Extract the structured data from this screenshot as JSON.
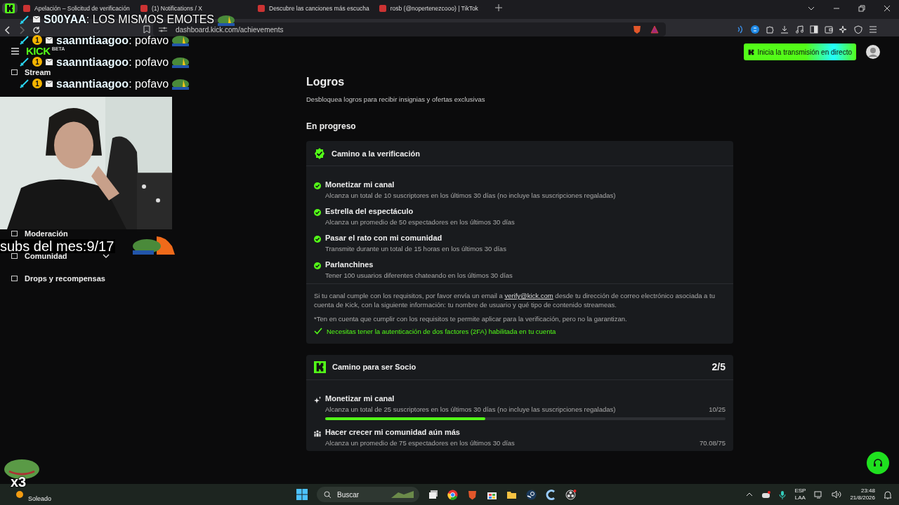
{
  "browser": {
    "tabs": [
      {
        "kind": "pinned",
        "selected": true
      },
      {
        "kind": "tab",
        "title": "Apelación – Solicitud de verificación",
        "selected": false
      },
      {
        "kind": "tab",
        "title": "(1) Notifications / X",
        "selected": false
      },
      {
        "kind": "tab",
        "title": "Descubre las canciones más escucha",
        "selected": false
      },
      {
        "kind": "tab",
        "title": "rosb (@nopertenezcooo) | TikTok",
        "selected": false
      }
    ],
    "address": "dashboard.kick.com/achievements"
  },
  "sidebar": {
    "logo": "KICK",
    "logo_badge": "BETA",
    "items": [
      {
        "label": "Stream",
        "kind": "link"
      },
      {
        "label": "Moderación",
        "kind": "link"
      },
      {
        "label": "Comunidad",
        "kind": "group",
        "expanded": false
      },
      {
        "label": "Drops y recompensas",
        "kind": "link"
      }
    ]
  },
  "header": {
    "live_button": "Inicia la transmisión en directo"
  },
  "page": {
    "title": "Logros",
    "subtitle": "Desbloquea logros para recibir insignias y ofertas exclusivas",
    "section": "En progreso"
  },
  "cards": [
    {
      "kind": "verification",
      "title": "Camino a la verificación",
      "items": [
        {
          "title": "Monetizar mi canal",
          "description": "Alcanza un total de 10 suscriptores en los últimos 30 días (no incluye las suscripciones regaladas)",
          "done": true
        },
        {
          "title": "Estrella del espectáculo",
          "description": "Alcanza un promedio de 50 espectadores en los últimos 30 días",
          "done": true
        },
        {
          "title": "Pasar el rato con mi comunidad",
          "description": "Transmite durante un total de 15 horas en los últimos 30 días",
          "done": true
        },
        {
          "title": "Parlanchines",
          "description": "Tener 100 usuarios diferentes chateando en los últimos 30 días",
          "done": true
        }
      ],
      "note": {
        "before": "Si tu canal cumple con los requisitos, por favor envía un email a ",
        "link": "verify@kick.com",
        "after": " desde tu dirección de correo electrónico asociada a tu cuenta de Kick, con la siguiente información: tu nombre de usuario y qué tipo de contenido streameas."
      },
      "disclaimer": "*Ten en cuenta que cumplir con los requisitos te permite aplicar para la verificación, pero no la garantizan.",
      "requirement": {
        "text": "Necesitas tener la autenticación de dos factores (2FA) habilitada en tu cuenta",
        "met": true
      }
    },
    {
      "kind": "partner",
      "title": "Camino para ser Socio",
      "count": "2/5",
      "items": [
        {
          "kind": "monetize",
          "title": "Monetizar mi canal",
          "description": "Alcanza un total de 25 suscriptores en los últimos 30 días (no incluye las suscripciones regaladas)",
          "reading": "10/25",
          "level": 0.4
        },
        {
          "kind": "community",
          "title": "Hacer crecer mi comunidad aún más",
          "description": "Alcanza un promedio de 75 espectadores en los últimos 30 días",
          "reading": "70.08/75"
        }
      ]
    }
  ],
  "overlay": {
    "chat": [
      {
        "text": "**S00YAA**: LOS MISMOS EMOTES"
      },
      {
        "text": "**saanntiaagoo**: pofavo",
        "badge": "1"
      },
      {
        "text": "**saanntiaagoo**: pofavo",
        "badge": "1"
      },
      {
        "text": "**saanntiaagoo**: pofavo",
        "badge": "1"
      }
    ],
    "subs": "subs del mes:9/17",
    "combo": "x3"
  },
  "taskbar": {
    "weather": "Soleado",
    "search": "Buscar",
    "language": "ESP",
    "layout": "LAA",
    "time": "23:48",
    "date": "21/8/2026"
  }
}
